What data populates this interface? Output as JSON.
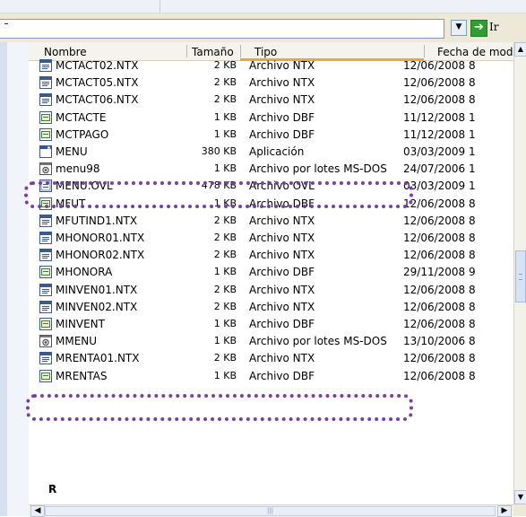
{
  "address_bar": {
    "go_label": "Ir"
  },
  "columns": {
    "name": "Nombre",
    "size": "Tamaño",
    "type": "Tipo",
    "date": "Fecha de mod"
  },
  "files": [
    {
      "name": "MCTACT02.NTX",
      "size": "2 KB",
      "type": "Archivo NTX",
      "date": "12/06/2008 8",
      "icon": "ntx-file-icon"
    },
    {
      "name": "MCTACT05.NTX",
      "size": "2 KB",
      "type": "Archivo NTX",
      "date": "12/06/2008 8",
      "icon": "ntx-file-icon"
    },
    {
      "name": "MCTACT06.NTX",
      "size": "2 KB",
      "type": "Archivo NTX",
      "date": "12/06/2008 8",
      "icon": "ntx-file-icon"
    },
    {
      "name": "MCTACTE",
      "size": "1 KB",
      "type": "Archivo DBF",
      "date": "11/12/2008 1",
      "icon": "dbf-file-icon"
    },
    {
      "name": "MCTPAGO",
      "size": "1 KB",
      "type": "Archivo DBF",
      "date": "11/12/2008 1",
      "icon": "dbf-file-icon"
    },
    {
      "name": "MENU",
      "size": "380 KB",
      "type": "Aplicación",
      "date": "03/03/2009 1",
      "icon": "application-icon"
    },
    {
      "name": "menu98",
      "size": "1 KB",
      "type": "Archivo por lotes MS-DOS",
      "date": "24/07/2006 1",
      "icon": "batch-file-icon"
    },
    {
      "name": "MENU.OVL",
      "size": "478 KB",
      "type": "Archivo OVL",
      "date": "03/03/2009 1",
      "icon": "ovl-file-icon"
    },
    {
      "name": "MFUT",
      "size": "1 KB",
      "type": "Archivo DBF",
      "date": "12/06/2008 8",
      "icon": "dbf-file-icon"
    },
    {
      "name": "MFUTIND1.NTX",
      "size": "2 KB",
      "type": "Archivo NTX",
      "date": "12/06/2008 8",
      "icon": "ntx-file-icon"
    },
    {
      "name": "MHONOR01.NTX",
      "size": "2 KB",
      "type": "Archivo NTX",
      "date": "12/06/2008 8",
      "icon": "ntx-file-icon"
    },
    {
      "name": "MHONOR02.NTX",
      "size": "2 KB",
      "type": "Archivo NTX",
      "date": "12/06/2008 8",
      "icon": "ntx-file-icon"
    },
    {
      "name": "MHONORA",
      "size": "1 KB",
      "type": "Archivo DBF",
      "date": "29/11/2008 9",
      "icon": "dbf-file-icon"
    },
    {
      "name": "MINVEN01.NTX",
      "size": "2 KB",
      "type": "Archivo NTX",
      "date": "12/06/2008 8",
      "icon": "ntx-file-icon"
    },
    {
      "name": "MINVEN02.NTX",
      "size": "2 KB",
      "type": "Archivo NTX",
      "date": "12/06/2008 8",
      "icon": "ntx-file-icon"
    },
    {
      "name": "MINVENT",
      "size": "1 KB",
      "type": "Archivo DBF",
      "date": "12/06/2008 8",
      "icon": "dbf-file-icon"
    },
    {
      "name": "MMENU",
      "size": "1 KB",
      "type": "Archivo por lotes MS-DOS",
      "date": "13/10/2006 8",
      "icon": "batch-file-icon"
    },
    {
      "name": "MRENTA01.NTX",
      "size": "2 KB",
      "type": "Archivo NTX",
      "date": "12/06/2008 8",
      "icon": "ntx-file-icon"
    },
    {
      "name": "MRENTAS",
      "size": "1 KB",
      "type": "Archivo DBF",
      "date": "12/06/2008 8",
      "icon": "dbf-file-icon"
    }
  ],
  "group_label": "R",
  "highlight_color": "#7b3fa0"
}
